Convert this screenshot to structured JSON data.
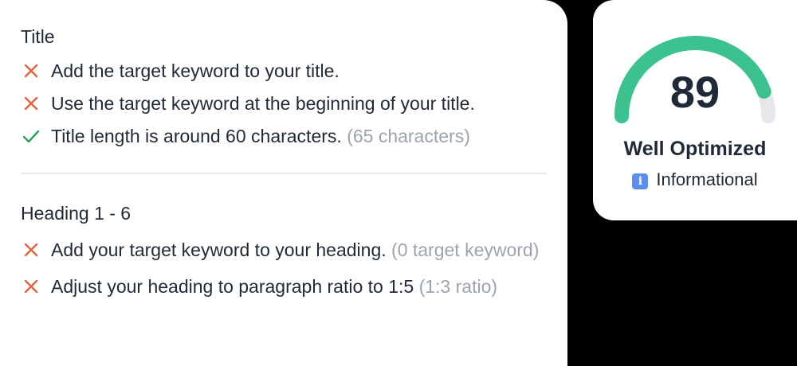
{
  "title_section": {
    "heading": "Title",
    "items": [
      {
        "status": "fail",
        "text": "Add the target keyword to your title.",
        "note": ""
      },
      {
        "status": "fail",
        "text": "Use the target keyword at the beginning of your title.",
        "note": ""
      },
      {
        "status": "pass",
        "text": "Title length is around 60 characters.",
        "note": "(65 characters)"
      }
    ]
  },
  "heading_section": {
    "heading": "Heading 1 - 6",
    "items": [
      {
        "status": "fail",
        "text": "Add your target keyword to your heading.",
        "note": "(0 target keyword)"
      },
      {
        "status": "fail",
        "text": "Adjust your heading to paragraph ratio to 1:5",
        "note": "(1:3 ratio)"
      }
    ]
  },
  "score_card": {
    "score": "89",
    "score_value": 89,
    "score_max": 100,
    "rating": "Well Optimized",
    "intent": "Informational",
    "intent_icon": "info-icon"
  },
  "colors": {
    "fail": "#e8613c",
    "pass": "#2f9e5b",
    "gauge_fill": "#3cc28f",
    "gauge_track": "#e5e7eb",
    "info_badge": "#5b8def"
  }
}
